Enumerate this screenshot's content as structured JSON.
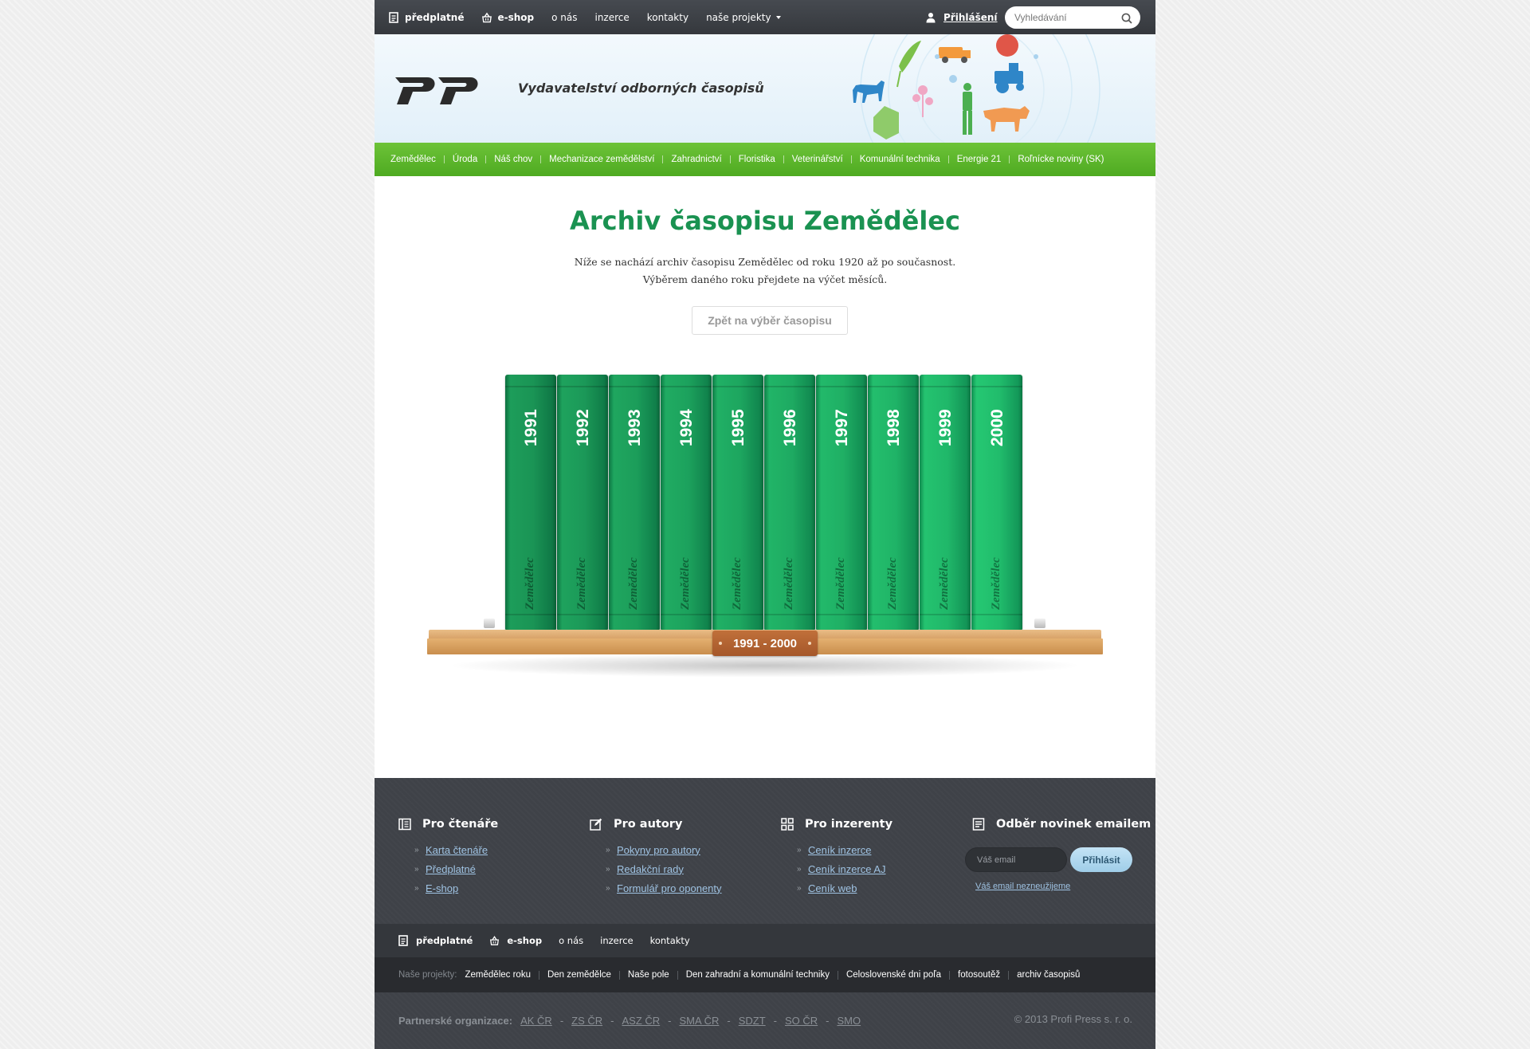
{
  "topbar": {
    "items": [
      {
        "label": "předplatné",
        "icon": "document-icon"
      },
      {
        "label": "e-shop",
        "icon": "basket-icon"
      },
      {
        "label": "o nás"
      },
      {
        "label": "inzerce"
      },
      {
        "label": "kontakty"
      },
      {
        "label": "naše projekty",
        "icon": "caret-down-icon"
      }
    ],
    "login_label": "Přihlášení",
    "search_placeholder": "Vyhledávání"
  },
  "header": {
    "logo_text": "PROFI PRESS",
    "tagline": "Vydavatelství odborných časopisů"
  },
  "magazines_nav": [
    "Zemědělec",
    "Úroda",
    "Náš chov",
    "Mechanizace zemědělství",
    "Zahradnictví",
    "Floristika",
    "Veterinářství",
    "Komunální technika",
    "Energie 21",
    "Roľnícke noviny (SK)"
  ],
  "main": {
    "title": "Archiv časopisu Zemědělec",
    "intro_line1": "Níže se nachází archiv časopisu Zemědělec od roku 1920 až po současnost.",
    "intro_line2": "Výběrem daného roku přejdete na výčet měsíců.",
    "back_button": "Zpět na výběr časopisu",
    "shelf": {
      "range_label": "1991 - 2000",
      "brand": "Zemědělec",
      "years": [
        "1991",
        "1992",
        "1993",
        "1994",
        "1995",
        "1996",
        "1997",
        "1998",
        "1999",
        "2000"
      ]
    }
  },
  "footer": {
    "readers": {
      "title": "Pro čtenáře",
      "links": [
        "Karta čtenáře",
        "Předplatné",
        "E-shop"
      ]
    },
    "authors": {
      "title": "Pro autory",
      "links": [
        "Pokyny pro autory",
        "Redakční rady",
        "Formulář pro oponenty"
      ]
    },
    "advertisers": {
      "title": "Pro inzerenty",
      "links": [
        "Ceník inzerce",
        "Ceník inzerce AJ",
        "Ceník web"
      ]
    },
    "newsletter": {
      "title": "Odběr novinek emailem",
      "placeholder": "Váš email",
      "button": "Přihlásit",
      "note": "Váš email nezneužijeme"
    },
    "nav": [
      {
        "label": "předplatné",
        "icon": "document-icon"
      },
      {
        "label": "e-shop",
        "icon": "basket-icon"
      },
      {
        "label": "o nás"
      },
      {
        "label": "inzerce"
      },
      {
        "label": "kontakty"
      }
    ],
    "projects_label": "Naše projekty:",
    "projects": [
      "Zemědělec roku",
      "Den zemědělce",
      "Naše pole",
      "Den zahradní a komunální techniky",
      "Celoslovenské dni poľa",
      "fotosoutěž",
      "archiv časopisů"
    ],
    "partners_label": "Partnerské organizace:",
    "partners": [
      "AK ČR",
      "ZS ČR",
      "ASZ ČR",
      "SMA ČR",
      "SDZT",
      "SO ČR",
      "SMO"
    ],
    "copyright": "© 2013 Profi Press s. r. o."
  }
}
